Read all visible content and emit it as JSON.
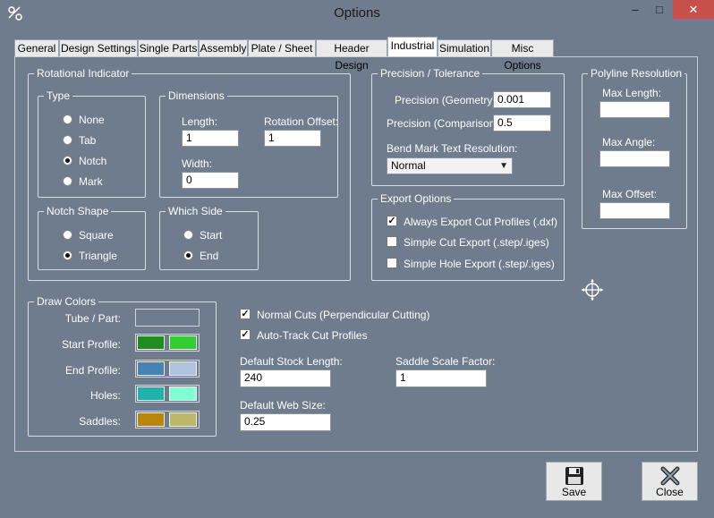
{
  "window": {
    "title": "Options",
    "minimize": "–",
    "maximize": "□",
    "close": "✕"
  },
  "tabs": [
    "General",
    "Design Settings",
    "Single Parts",
    "Assembly",
    "Plate / Sheet",
    "Header Design",
    "Industrial",
    "Simulation",
    "Misc Options"
  ],
  "active_tab": "Industrial",
  "rotational": {
    "title": "Rotational Indicator",
    "type": {
      "title": "Type",
      "options": [
        "None",
        "Tab",
        "Notch",
        "Mark"
      ],
      "selected": "Notch"
    },
    "dimensions": {
      "title": "Dimensions",
      "length_label": "Length:",
      "length_value": "1",
      "rotation_label": "Rotation Offset:",
      "rotation_value": "1",
      "width_label": "Width:",
      "width_value": "0"
    },
    "notch_shape": {
      "title": "Notch Shape",
      "options": [
        "Square",
        "Triangle"
      ],
      "selected": "Triangle"
    },
    "which_side": {
      "title": "Which Side",
      "options": [
        "Start",
        "End"
      ],
      "selected": "End"
    }
  },
  "precision": {
    "title": "Precision / Tolerance",
    "geometry_label": "Precision (Geometry):",
    "geometry_value": "0.001",
    "comparison_label": "Precision (Comparison):",
    "comparison_value": "0.5",
    "bend_label": "Bend Mark Text Resolution:",
    "bend_value": "Normal"
  },
  "export": {
    "title": "Export Options",
    "items": [
      {
        "label": "Always Export Cut Profiles (.dxf)",
        "checked": true
      },
      {
        "label": "Simple Cut Export (.step/.iges)",
        "checked": false
      },
      {
        "label": "Simple Hole Export (.step/.iges)",
        "checked": false
      }
    ]
  },
  "polyline": {
    "title": "Polyline Resolution",
    "max_length_label": "Max Length:",
    "max_length_value": "",
    "max_angle_label": "Max Angle:",
    "max_angle_value": "",
    "max_offset_label": "Max Offset:",
    "max_offset_value": ""
  },
  "draw_colors": {
    "title": "Draw Colors",
    "rows": [
      {
        "label": "Tube / Part:",
        "colors": [
          "#6e7c8e"
        ]
      },
      {
        "label": "Start Profile:",
        "colors": [
          "#228b22",
          "#32cd32"
        ]
      },
      {
        "label": "End Profile:",
        "colors": [
          "#4682b4",
          "#b0c4de"
        ]
      },
      {
        "label": "Holes:",
        "colors": [
          "#20b2aa",
          "#7fffd4"
        ]
      },
      {
        "label": "Saddles:",
        "colors": [
          "#b8860b",
          "#bdb76b"
        ]
      }
    ]
  },
  "options": {
    "normal_cuts_label": "Normal Cuts (Perpendicular Cutting)",
    "normal_cuts_checked": true,
    "autotrack_label": "Auto-Track Cut Profiles",
    "autotrack_checked": true,
    "stock_length_label": "Default Stock Length:",
    "stock_length_value": "240",
    "saddle_label": "Saddle Scale Factor:",
    "saddle_value": "1",
    "web_size_label": "Default Web Size:",
    "web_size_value": "0.25"
  },
  "buttons": {
    "save": "Save",
    "close": "Close"
  },
  "colors": {
    "background": "#6e7c8e",
    "close_button": "#c7504a"
  }
}
